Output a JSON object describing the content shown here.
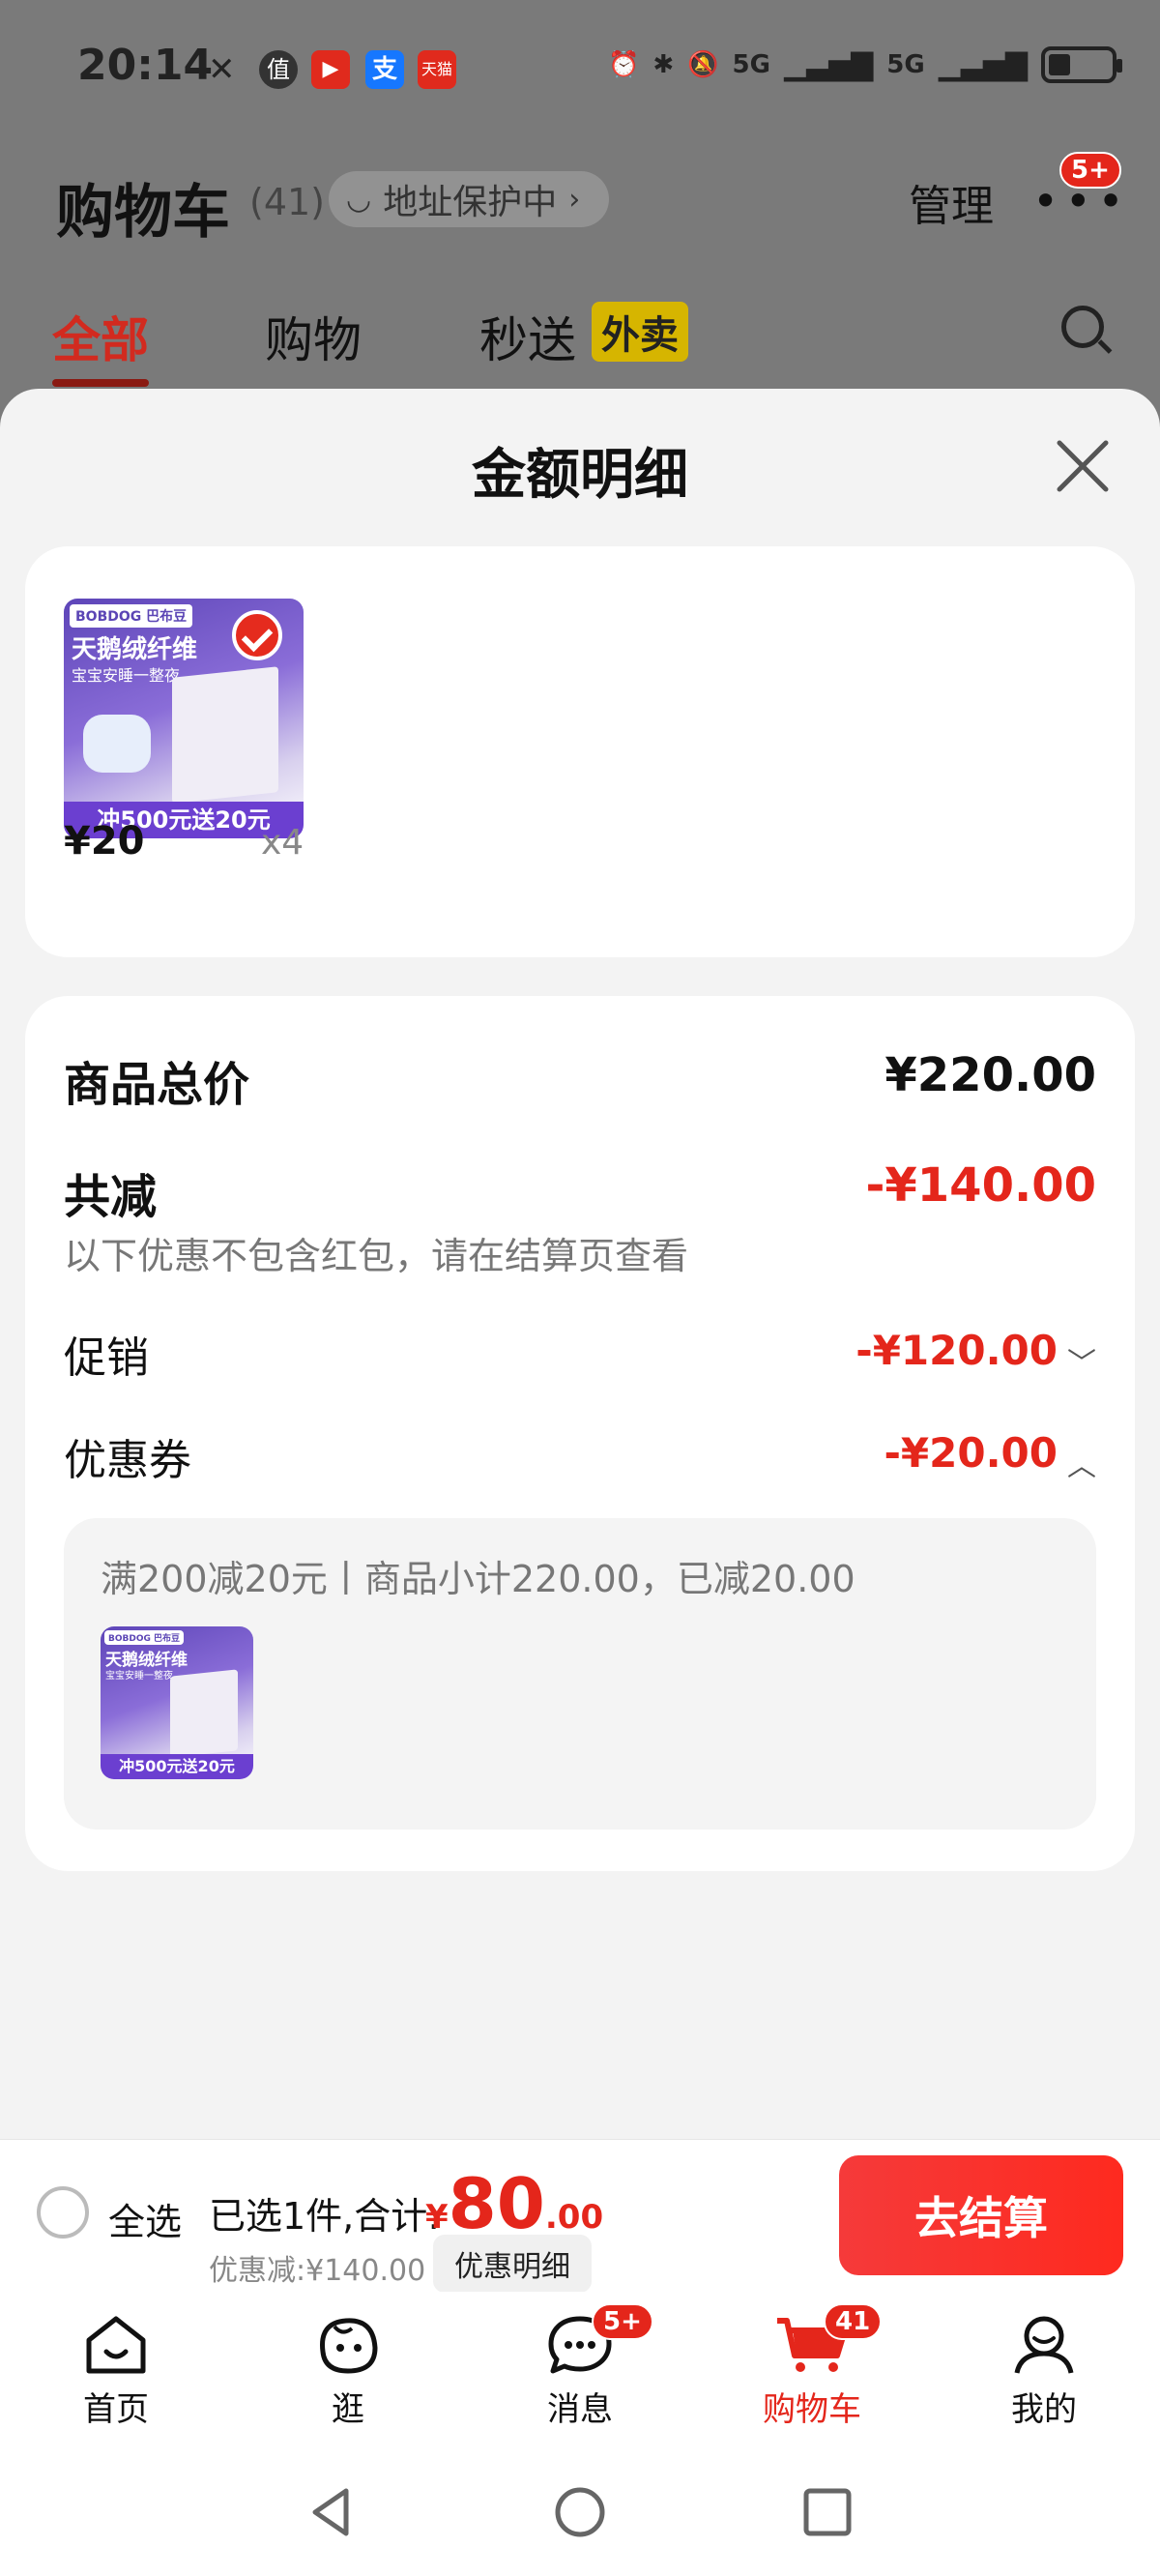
{
  "status_bar": {
    "time": "20:14",
    "net1": "5G",
    "net2": "5G",
    "app_icons": [
      "值",
      "▶",
      "支",
      "天猫"
    ]
  },
  "header": {
    "title": "购物车",
    "count": "(41)",
    "address": "地址保护中",
    "manage": "管理",
    "more_badge": "5+"
  },
  "tabs": [
    {
      "label": "全部"
    },
    {
      "label": "购物"
    },
    {
      "label": "秒送"
    }
  ],
  "tab_tag": "外卖",
  "sheet": {
    "title": "金额明细",
    "product": {
      "brand": "BOBDOG 巴布豆",
      "headline": "天鹅绒纤维",
      "tagline": "宝宝安睡一整夜",
      "promo": "冲500元送20元",
      "price": "¥20",
      "quantity": "x4"
    },
    "summary": {
      "total_label": "商品总价",
      "total_value": "¥220.00",
      "reduce_label": "共减",
      "reduce_value": "-¥140.00",
      "note": "以下优惠不包含红包，请在结算页查看",
      "promo_label": "促销",
      "promo_value": "-¥120.00",
      "coupon_label": "优惠券",
      "coupon_value": "-¥20.00",
      "coupon_desc": "满200减20元丨商品小计220.00，已减20.00"
    }
  },
  "bottom_bar": {
    "select_all": "全选",
    "selected_text": "已选1件,合计:",
    "currency": "¥",
    "amount_int": "80",
    "amount_dec": ".00",
    "discount": "优惠减:¥140.00",
    "detail_button": "优惠明细",
    "checkout": "去结算"
  },
  "nav": {
    "items": [
      {
        "label": "首页"
      },
      {
        "label": "逛"
      },
      {
        "label": "消息",
        "badge": "5+"
      },
      {
        "label": "购物车",
        "badge": "41"
      },
      {
        "label": "我的"
      }
    ]
  },
  "colors": {
    "accent": "#e4261b",
    "overlay": "#7a7a7a",
    "sheet_bg": "#f3f3f3"
  }
}
